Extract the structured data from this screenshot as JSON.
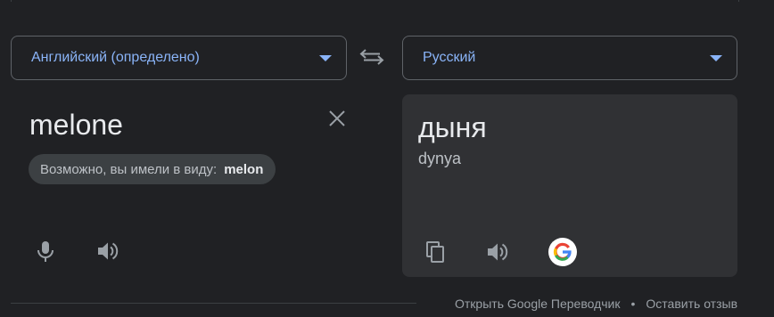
{
  "source": {
    "language": "Английский (определено)",
    "text": "melone",
    "suggestion_prefix": "Возможно, вы имели в виду:",
    "suggestion_word": "melon"
  },
  "target": {
    "language": "Русский",
    "text": "дыня",
    "transliteration": "dynya"
  },
  "footer": {
    "open_link": "Открыть Google Переводчик",
    "separator": "•",
    "feedback_link": "Оставить отзыв"
  },
  "colors": {
    "background": "#202124",
    "panel": "#303134",
    "accent": "#8ab4f8",
    "text": "#e8eaed",
    "muted": "#9aa0a6"
  },
  "icons": [
    "swap-languages-icon",
    "close-icon",
    "microphone-icon",
    "speaker-icon",
    "copy-icon",
    "google-logo-icon",
    "caret-down-icon"
  ]
}
